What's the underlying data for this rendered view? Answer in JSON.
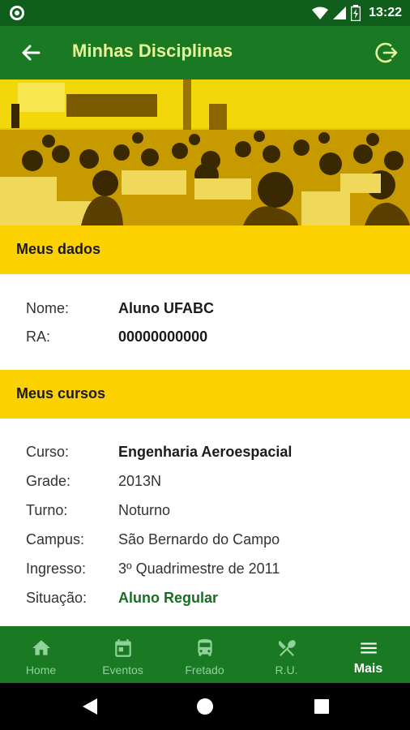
{
  "status_bar": {
    "time": "13:22"
  },
  "app_bar": {
    "title": "Minhas Disciplinas",
    "back_icon": "arrow-back-icon",
    "logout_icon": "logout-icon"
  },
  "hero": {
    "image": "lecture-hall-photo"
  },
  "meus_dados": {
    "title": "Meus dados",
    "rows": [
      {
        "label": "Nome:",
        "value": "Aluno UFABC"
      },
      {
        "label": "RA:",
        "value": "00000000000"
      }
    ]
  },
  "meus_cursos": {
    "title": "Meus cursos",
    "rows": [
      {
        "label": "Curso:",
        "value": "Engenharia Aeroespacial"
      },
      {
        "label": "Grade:",
        "value": "2013N"
      },
      {
        "label": "Turno:",
        "value": "Noturno"
      },
      {
        "label": "Campus:",
        "value": "São Bernardo do Campo"
      },
      {
        "label": "Ingresso:",
        "value": "3º Quadrimestre de 2011"
      },
      {
        "label": "Situação:",
        "value": "Aluno Regular"
      }
    ]
  },
  "bottom_nav": {
    "items": [
      {
        "label": "Home",
        "icon": "home-icon"
      },
      {
        "label": "Eventos",
        "icon": "calendar-icon"
      },
      {
        "label": "Fretado",
        "icon": "bus-icon"
      },
      {
        "label": "R.U.",
        "icon": "restaurant-icon"
      },
      {
        "label": "Mais",
        "icon": "menu-icon",
        "active": true
      }
    ]
  },
  "colors": {
    "primary": "#1a7a23",
    "status_bar": "#0f5e1b",
    "section_header": "#fcd100",
    "title_text": "#e6f59a",
    "accent_green": "#1a6e22"
  }
}
